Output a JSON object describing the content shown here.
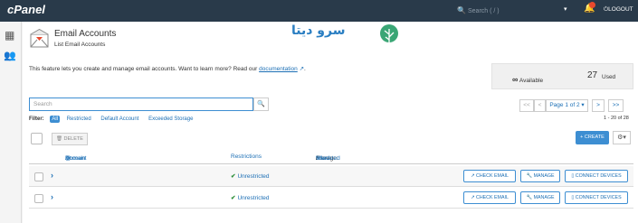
{
  "topbar": {
    "logo": "cPanel",
    "search_placeholder": "Search ( / )",
    "search_icon": "search-icon",
    "user_chevron": "▾",
    "notifications_icon": "bell-icon",
    "logout_label": "LOGOUT",
    "logout_icon": "power-icon"
  },
  "sidebar": {
    "items": [
      {
        "icon": "grid-icon"
      },
      {
        "icon": "users-icon"
      }
    ]
  },
  "page": {
    "title": "Email Accounts",
    "subtitle": "List Email Accounts",
    "brand_text": "سرو دیتا",
    "description": "This feature lets you create and manage email accounts. Want to learn more? Read our",
    "description_link": "documentation",
    "description_end": "."
  },
  "stats": {
    "available_symbol": "∞",
    "available_label": "Available",
    "used_count": "27",
    "used_label": "Used"
  },
  "search": {
    "placeholder": "Search"
  },
  "pagination": {
    "first": "<<",
    "prev": "<",
    "current": "Page 1 of 2 ▾",
    "next": ">",
    "last": ">>",
    "range": "1 - 20 of 28"
  },
  "filter": {
    "label": "Filter:",
    "options": [
      "All",
      "Restricted",
      "Default Account",
      "Exceeded Storage"
    ]
  },
  "toolbar": {
    "delete_label": "DELETE",
    "create_label": "+ CREATE",
    "settings_icon": "gear-icon"
  },
  "table": {
    "col_account": "Account",
    "col_at": "@",
    "col_domain": "Domain",
    "col_restrictions": "Restrictions",
    "col_storage": "Storage:",
    "col_used": "Used",
    "col_sep1": "/",
    "col_allocated": "Allocated",
    "col_sep2": "/",
    "col_percent": "%",
    "rows": [
      {
        "restriction": "Unrestricted",
        "check_email": "CHECK EMAIL",
        "manage": "MANAGE",
        "connect": "CONNECT DEVICES"
      },
      {
        "restriction": "Unrestricted",
        "check_email": "CHECK EMAIL",
        "manage": "MANAGE",
        "connect": "CONNECT DEVICES"
      }
    ]
  },
  "colors": {
    "topbar": "#293a4a",
    "accent": "#3d8ed2",
    "link": "#1c6fb5",
    "success": "#2e8f3a"
  }
}
